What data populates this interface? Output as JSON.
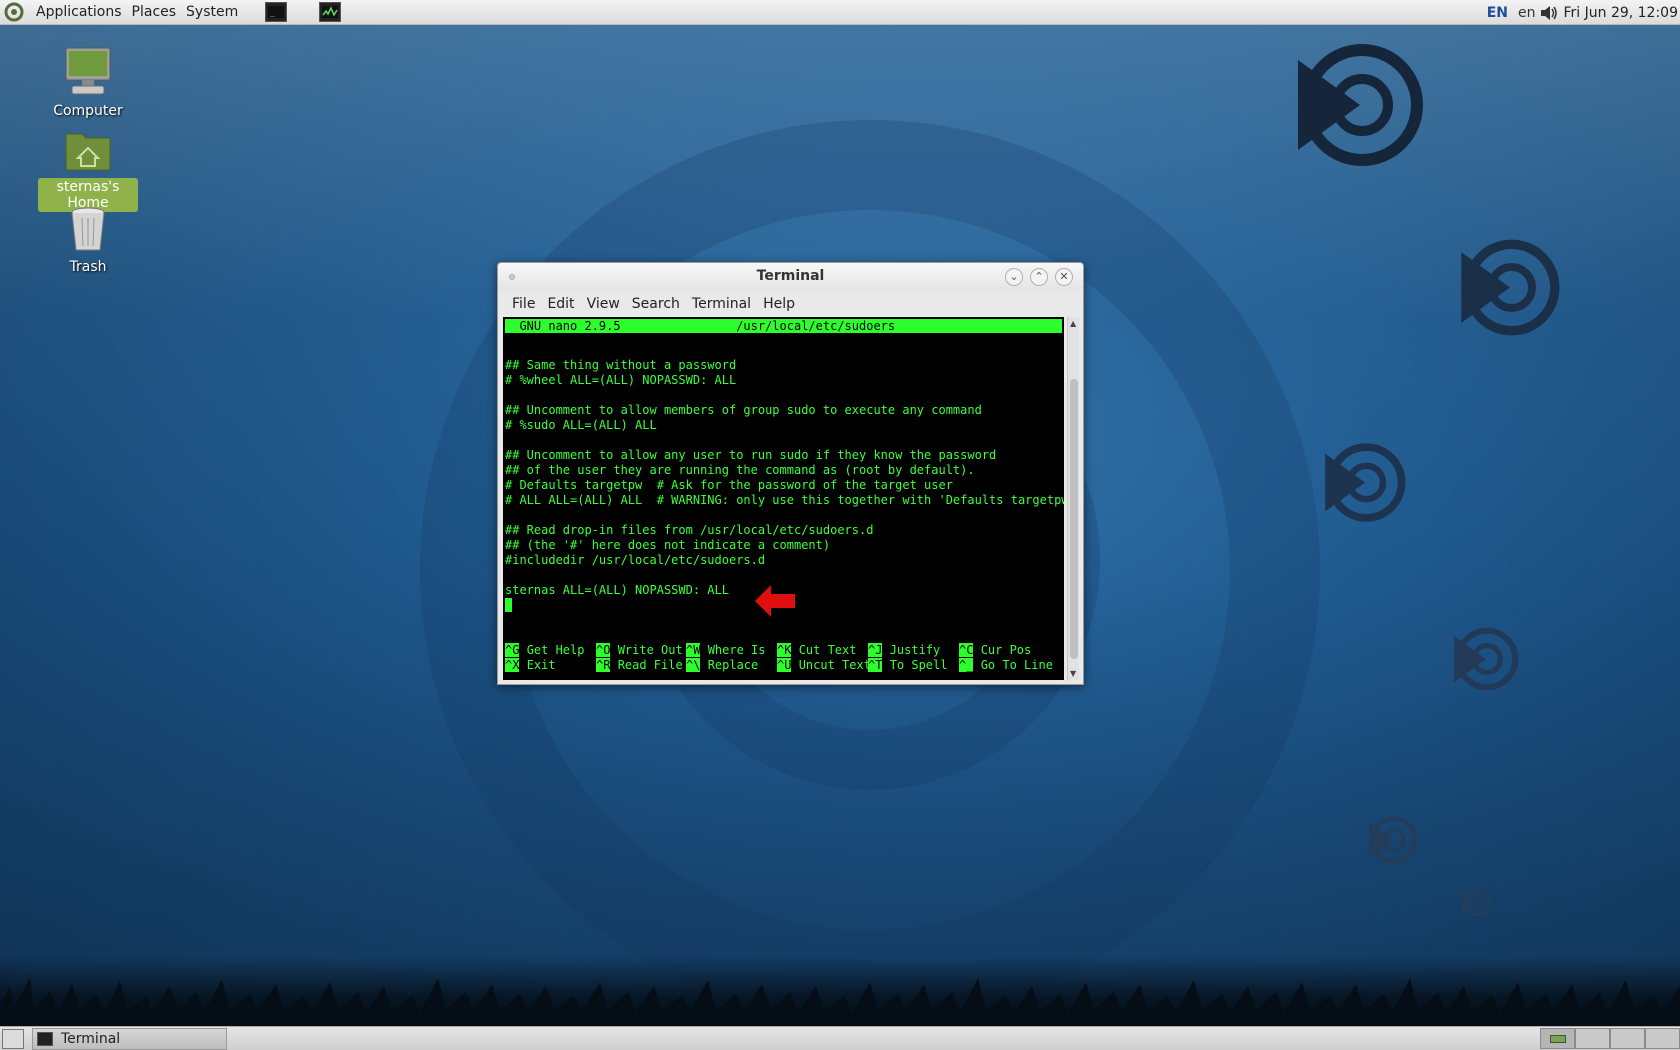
{
  "panel": {
    "menus": [
      "Applications",
      "Places",
      "System"
    ],
    "keyboard_layout": "EN",
    "language": "en",
    "clock": "Fri Jun 29, 12:09"
  },
  "desktop": {
    "icons": [
      {
        "label": "Computer"
      },
      {
        "label": "sternas's Home",
        "selected": true
      },
      {
        "label": "Trash"
      }
    ]
  },
  "window": {
    "title": "Terminal",
    "menus": [
      "File",
      "Edit",
      "View",
      "Search",
      "Terminal",
      "Help"
    ]
  },
  "nano": {
    "header": "  GNU nano 2.9.5                /usr/local/etc/sudoers",
    "lines": [
      "",
      "## Same thing without a password",
      "# %wheel ALL=(ALL) NOPASSWD: ALL",
      "",
      "## Uncomment to allow members of group sudo to execute any command",
      "# %sudo ALL=(ALL) ALL",
      "",
      "## Uncomment to allow any user to run sudo if they know the password",
      "## of the user they are running the command as (root by default).",
      "# Defaults targetpw  # Ask for the password of the target user",
      "# ALL ALL=(ALL) ALL  # WARNING: only use this together with 'Defaults targetpw'",
      "",
      "## Read drop-in files from /usr/local/etc/sudoers.d",
      "## (the '#' here does not indicate a comment)",
      "#includedir /usr/local/etc/sudoers.d",
      "",
      "sternas ALL=(ALL) NOPASSWD: ALL"
    ],
    "shortcuts_row1": [
      {
        "key": "^G",
        "label": "Get Help"
      },
      {
        "key": "^O",
        "label": "Write Out"
      },
      {
        "key": "^W",
        "label": "Where Is"
      },
      {
        "key": "^K",
        "label": "Cut Text"
      },
      {
        "key": "^J",
        "label": "Justify"
      },
      {
        "key": "^C",
        "label": "Cur Pos"
      }
    ],
    "shortcuts_row2": [
      {
        "key": "^X",
        "label": "Exit"
      },
      {
        "key": "^R",
        "label": "Read File"
      },
      {
        "key": "^\\",
        "label": "Replace"
      },
      {
        "key": "^U",
        "label": "Uncut Text"
      },
      {
        "key": "^T",
        "label": "To Spell"
      },
      {
        "key": "^_",
        "label": "Go To Line"
      }
    ]
  },
  "taskbar": {
    "task_label": "Terminal"
  },
  "colors": {
    "terminal_text": "#3cff3c",
    "nano_bar": "#2cff2c",
    "annotation_arrow": "#e01010",
    "selected_icon_bg": "#8fb34a"
  }
}
